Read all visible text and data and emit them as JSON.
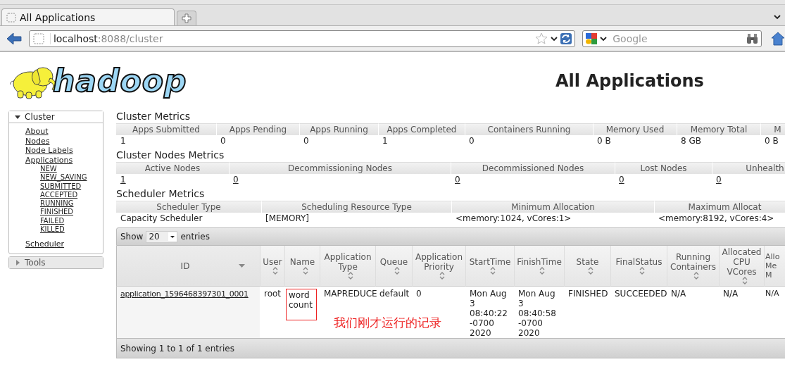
{
  "browser": {
    "tabs": [
      {
        "title": "All Applications"
      }
    ],
    "address": {
      "host": "localhost",
      "path": ":8088/cluster"
    },
    "search": {
      "placeholder": "Google"
    }
  },
  "logo_text": "hadoop",
  "title": "All Applications",
  "sidebar": [
    {
      "label": "Cluster",
      "expanded": true,
      "items": [
        {
          "label": "About"
        },
        {
          "label": "Nodes"
        },
        {
          "label": "Node Labels"
        },
        {
          "label": "Applications",
          "children": [
            {
              "label": "NEW"
            },
            {
              "label": "NEW_SAVING"
            },
            {
              "label": "SUBMITTED"
            },
            {
              "label": "ACCEPTED"
            },
            {
              "label": "RUNNING"
            },
            {
              "label": "FINISHED"
            },
            {
              "label": "FAILED"
            },
            {
              "label": "KILLED"
            }
          ]
        },
        {
          "label": "Scheduler"
        }
      ]
    },
    {
      "label": "Tools",
      "expanded": false
    }
  ],
  "metrics": [
    {
      "title": "Cluster Metrics",
      "values_linked": false,
      "columns": [
        "Apps Submitted",
        "Apps Pending",
        "Apps Running",
        "Apps Completed",
        "Containers Running",
        "Memory Used",
        "Memory Total",
        "M"
      ],
      "values": [
        "1",
        "0",
        "0",
        "1",
        "0",
        "0 B",
        "8 GB",
        "0 B"
      ]
    },
    {
      "title": "Cluster Nodes Metrics",
      "values_linked": true,
      "columns": [
        "Active Nodes",
        "Decommissioning Nodes",
        "Decommissioned Nodes",
        "Lost Nodes",
        "Unhealth"
      ],
      "values": [
        "1",
        "0",
        "0",
        "0",
        "0"
      ]
    },
    {
      "title": "Scheduler Metrics",
      "values_linked": false,
      "columns": [
        "Scheduler Type",
        "Scheduling Resource Type",
        "Minimum Allocation",
        "Maximum Allocat"
      ],
      "values": [
        "Capacity Scheduler",
        "[MEMORY]",
        "<memory:1024, vCores:1>",
        "<memory:8192, vCores:4>"
      ]
    }
  ],
  "apps": {
    "show_label": "Show",
    "page_size": "20",
    "entries_label": "entries",
    "columns": [
      {
        "label": "ID",
        "sorted_descending": true
      },
      {
        "label": "User",
        "sorted_descending": false
      },
      {
        "label": "Name",
        "sorted_descending": false
      },
      {
        "label": "Application Type",
        "sorted_descending": false
      },
      {
        "label": "Queue",
        "sorted_descending": false
      },
      {
        "label": "Application Priority",
        "sorted_descending": false
      },
      {
        "label": "StartTime",
        "sorted_descending": false
      },
      {
        "label": "FinishTime",
        "sorted_descending": false
      },
      {
        "label": "State",
        "sorted_descending": false
      },
      {
        "label": "FinalStatus",
        "sorted_descending": false
      },
      {
        "label": "Running Containers",
        "sorted_descending": false
      },
      {
        "label": "Allocated CPU VCores",
        "sorted_descending": false
      },
      {
        "label": "Allo Me M",
        "sorted_descending": false
      }
    ],
    "rows": [
      {
        "cells": [
          {
            "text": "application_1596468397301_0001",
            "highlighted": false
          },
          {
            "text": "root",
            "highlighted": false
          },
          {
            "text": "word count",
            "highlighted": true
          },
          {
            "text": "MAPREDUCE",
            "highlighted": false
          },
          {
            "text": "default",
            "highlighted": false
          },
          {
            "text": "0",
            "highlighted": false
          },
          {
            "text": "Mon Aug 3 08:40:22 -0700 2020",
            "highlighted": false
          },
          {
            "text": "Mon Aug 3 08:40:58 -0700 2020",
            "highlighted": false
          },
          {
            "text": "FINISHED",
            "highlighted": false
          },
          {
            "text": "SUCCEEDED",
            "highlighted": false
          },
          {
            "text": "N/A",
            "highlighted": false
          },
          {
            "text": "N/A",
            "highlighted": false
          },
          {
            "text": "N/A",
            "highlighted": false
          }
        ]
      }
    ],
    "annotation": "我们刚才运行的记录",
    "footer": "Showing 1 to 1 of 1 entries"
  }
}
